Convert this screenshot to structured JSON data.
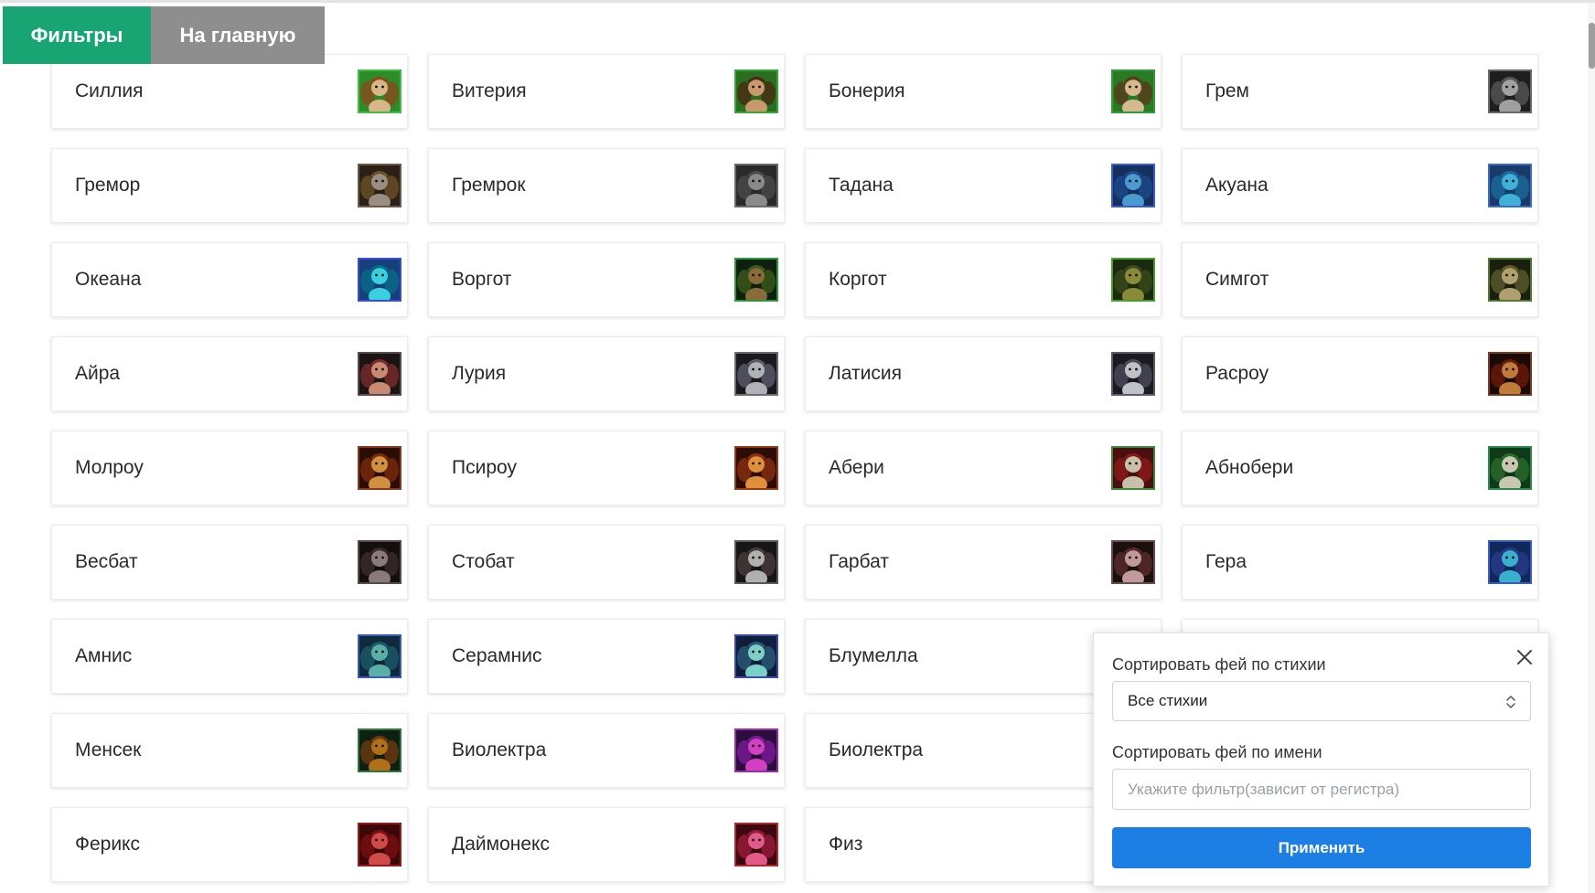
{
  "nav": {
    "filters_label": "Фильтры",
    "home_label": "На главную"
  },
  "fairies": [
    {
      "name": "Силлия",
      "frame": "#3cbf44",
      "bg": "#2f8a2a",
      "fig": "#d9b58a",
      "acc": "#8a4a1a"
    },
    {
      "name": "Витерия",
      "frame": "#3aa33a",
      "bg": "#2a6e22",
      "fig": "#c89a6b",
      "acc": "#4a2a14"
    },
    {
      "name": "Бонерия",
      "frame": "#2f9c3a",
      "bg": "#2a7a24",
      "fig": "#d6b891",
      "acc": "#5a3a1a"
    },
    {
      "name": "Грем",
      "frame": "#6a6a6a",
      "bg": "#1e1e1e",
      "fig": "#a0a0a0",
      "acc": "#555555"
    },
    {
      "name": "Гремор",
      "frame": "#6b5a44",
      "bg": "#2a2018",
      "fig": "#9a8e80",
      "acc": "#6a5028"
    },
    {
      "name": "Гремрок",
      "frame": "#6a6a6a",
      "bg": "#2a2a2a",
      "fig": "#8a8a8a",
      "acc": "#4a4a4a"
    },
    {
      "name": "Тадана",
      "frame": "#3a5bd8",
      "bg": "#16305e",
      "fig": "#4a9ad0",
      "acc": "#1a4a8a"
    },
    {
      "name": "Акуана",
      "frame": "#3a6bc8",
      "bg": "#1a3a6a",
      "fig": "#3fb0d8",
      "acc": "#1a6a9a"
    },
    {
      "name": "Океана",
      "frame": "#3a4fd0",
      "bg": "#16407a",
      "fig": "#3ad0e0",
      "acc": "#0a6a8a"
    },
    {
      "name": "Воргот",
      "frame": "#2c9a3a",
      "bg": "#0f1f0f",
      "fig": "#8a6a3a",
      "acc": "#3a5a1a"
    },
    {
      "name": "Коргот",
      "frame": "#4c9c2a",
      "bg": "#1a2a10",
      "fig": "#8a8a3a",
      "acc": "#3a4a1a"
    },
    {
      "name": "Симгот",
      "frame": "#4a7a2a",
      "bg": "#1a1f10",
      "fig": "#b0a070",
      "acc": "#5a5a2a"
    },
    {
      "name": "Айра",
      "frame": "#5a4a4a",
      "bg": "#1a1414",
      "fig": "#c88a70",
      "acc": "#7a2a2a"
    },
    {
      "name": "Лурия",
      "frame": "#6a6a72",
      "bg": "#1a1a1e",
      "fig": "#b0b0b8",
      "acc": "#5a5a6a"
    },
    {
      "name": "Латисия",
      "frame": "#5a5a6a",
      "bg": "#1a1a20",
      "fig": "#c0c0c8",
      "acc": "#4a4a5a"
    },
    {
      "name": "Расроу",
      "frame": "#7a3a1a",
      "bg": "#1a0a06",
      "fig": "#c07a3a",
      "acc": "#6a1a0a"
    },
    {
      "name": "Молроу",
      "frame": "#8a3a1a",
      "bg": "#2a0e06",
      "fig": "#d09040",
      "acc": "#7a2a0a"
    },
    {
      "name": "Псироу",
      "frame": "#9a3a14",
      "bg": "#2a0e06",
      "fig": "#e0903a",
      "acc": "#8a3010"
    },
    {
      "name": "Абери",
      "frame": "#3a8a3a",
      "bg": "#4a0f0f",
      "fig": "#c8c0a8",
      "acc": "#8a1a1a"
    },
    {
      "name": "Абнобери",
      "frame": "#2a8a4a",
      "bg": "#0f3a1a",
      "fig": "#c8c8b0",
      "acc": "#2a6a2a"
    },
    {
      "name": "Весбат",
      "frame": "#5a4a4a",
      "bg": "#140f0f",
      "fig": "#8a7a7a",
      "acc": "#3a2a2a"
    },
    {
      "name": "Стобат",
      "frame": "#5a5a5a",
      "bg": "#161616",
      "fig": "#b0b0b0",
      "acc": "#4a3a3a"
    },
    {
      "name": "Гарбат",
      "frame": "#6a4a4a",
      "bg": "#1a1010",
      "fig": "#c09a9a",
      "acc": "#5a2a2a"
    },
    {
      "name": "Гера",
      "frame": "#3a5ad0",
      "bg": "#0f2a5a",
      "fig": "#3ab0d0",
      "acc": "#2a3a8a"
    },
    {
      "name": "Амнис",
      "frame": "#3a5ac0",
      "bg": "#0f2a3a",
      "fig": "#5ab0a8",
      "acc": "#1a5a6a"
    },
    {
      "name": "Серамнис",
      "frame": "#3a4ab0",
      "bg": "#0f1f3a",
      "fig": "#7ad0c8",
      "acc": "#2a5a7a"
    },
    {
      "name": "Блумелла"
    },
    {
      "name": ""
    },
    {
      "name": "Менсек",
      "frame": "#2a7a3a",
      "bg": "#0f1f14",
      "fig": "#b0701a",
      "acc": "#6a3a10"
    },
    {
      "name": "Виолектра",
      "frame": "#9a2ab0",
      "bg": "#2a0f3a",
      "fig": "#d040c0",
      "acc": "#7a1a9a"
    },
    {
      "name": "Биолектра"
    },
    {
      "name": ""
    },
    {
      "name": "Ферикс",
      "frame": "#9a1a1a",
      "bg": "#3a0808",
      "fig": "#d04a4a",
      "acc": "#7a1010"
    },
    {
      "name": "Даймонекс",
      "frame": "#b02a2a",
      "bg": "#3a0a10",
      "fig": "#e05a8a",
      "acc": "#9a1a3a"
    },
    {
      "name": "Физ"
    },
    {
      "name": ""
    }
  ],
  "filter_panel": {
    "element_label": "Сортировать фей по стихии",
    "element_value": "Все стихии",
    "name_label": "Сортировать фей по имени",
    "name_placeholder": "Укажите фильтр(зависит от регистра)",
    "name_value": "",
    "apply_label": "Применить"
  },
  "colors": {
    "tab_active": "#19a573",
    "tab_inactive": "#8e8e8e",
    "apply_button": "#1d7fe3"
  }
}
